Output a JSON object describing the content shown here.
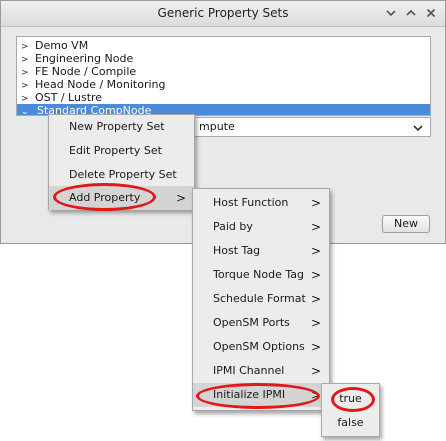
{
  "window": {
    "title": "Generic Property Sets",
    "buttons": {
      "minimize": "chevron-down",
      "maximize": "chevron-up",
      "close": "close-x"
    }
  },
  "tree": {
    "items": [
      {
        "label": "Demo VM",
        "expanded": false
      },
      {
        "label": "Engineering Node",
        "expanded": false
      },
      {
        "label": "FE Node / Compile",
        "expanded": false
      },
      {
        "label": "Head Node / Monitoring",
        "expanded": false
      },
      {
        "label": "OST / Lustre",
        "expanded": false
      },
      {
        "label": "Standard CompNode",
        "expanded": true,
        "selected": true
      }
    ]
  },
  "combo": {
    "value": "mpute"
  },
  "new_button": "New",
  "context_menu": {
    "items": [
      {
        "label": "New Property Set"
      },
      {
        "label": "Edit Property Set"
      },
      {
        "label": "Delete Property Set"
      },
      {
        "label": "Add Property",
        "submenu_arrow": ">"
      }
    ]
  },
  "property_menu": {
    "items": [
      {
        "label": "Host Function",
        "submenu_arrow": ">"
      },
      {
        "label": "Paid by",
        "submenu_arrow": ">"
      },
      {
        "label": "Host Tag",
        "submenu_arrow": ">"
      },
      {
        "label": "Torque Node Tag",
        "submenu_arrow": ">"
      },
      {
        "label": "Schedule Format",
        "submenu_arrow": ">"
      },
      {
        "label": "OpenSM Ports",
        "submenu_arrow": ">"
      },
      {
        "label": "OpenSM Options",
        "submenu_arrow": ">"
      },
      {
        "label": "IPMI Channel",
        "submenu_arrow": ">"
      },
      {
        "label": "Initialize IPMI",
        "submenu_arrow": ">"
      }
    ]
  },
  "value_menu": {
    "items": [
      {
        "label": "true"
      },
      {
        "label": "false"
      }
    ]
  },
  "colors": {
    "selection": "#4a8bdc",
    "annotation": "#e01818",
    "menu_bg": "#ececec"
  }
}
